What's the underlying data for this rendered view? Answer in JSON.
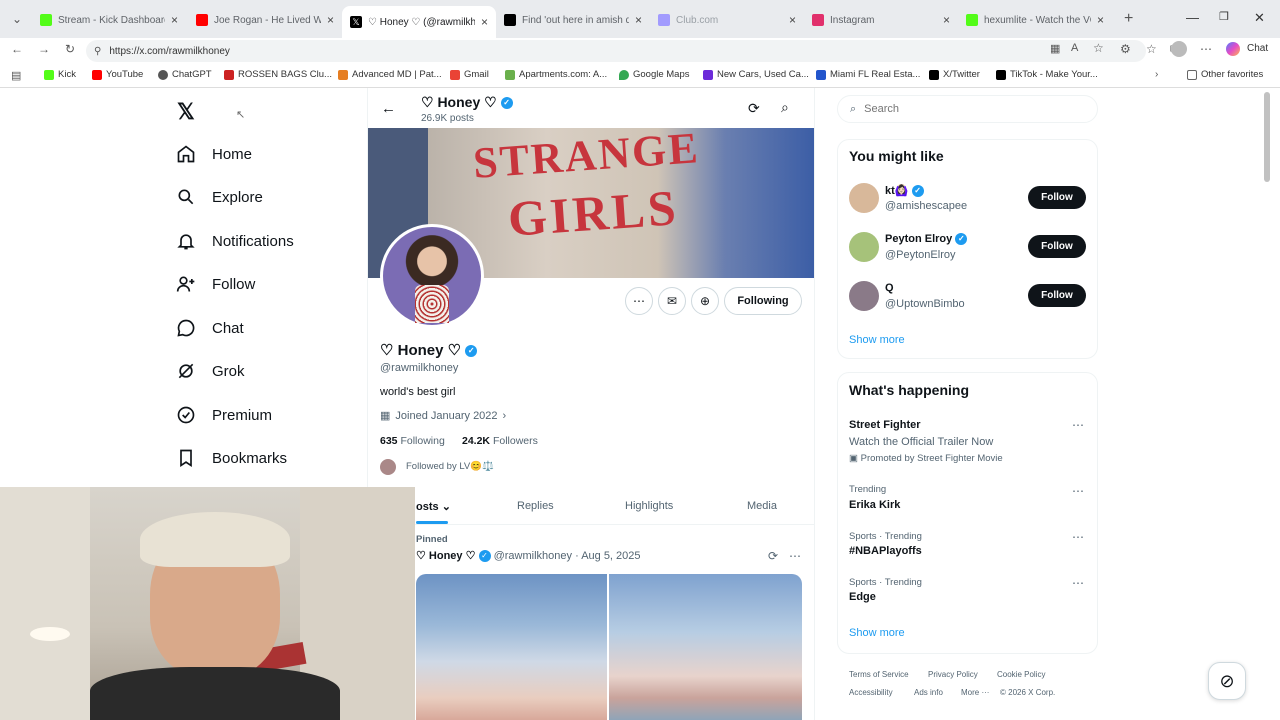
{
  "tabs": [
    {
      "title": "Stream - Kick Dashboard",
      "color": "#53fc18"
    },
    {
      "title": "Joe Rogan - He Lived With M",
      "color": "#ff0000"
    },
    {
      "title": "♡ Honey ♡ (@rawmilkhoney",
      "color": "#000000"
    },
    {
      "title": "Find 'out here in amish doin",
      "color": "#000000"
    },
    {
      "title": "Club.com",
      "color": "#a29bfe"
    },
    {
      "title": "Instagram",
      "color": "#e1306c"
    },
    {
      "title": "hexumlite - Watch the VOD",
      "color": "#53fc18"
    }
  ],
  "address": {
    "url": "https://x.com/rawmilkhoney"
  },
  "browser": {
    "chat_label": "Chat"
  },
  "bookmarks": [
    {
      "label": "Kick",
      "color": "#53fc18"
    },
    {
      "label": "YouTube",
      "color": "#ff0000"
    },
    {
      "label": "ChatGPT",
      "color": "#555555"
    },
    {
      "label": "ROSSEN BAGS Clu...",
      "color": "#cc2222"
    },
    {
      "label": "Advanced MD | Pat...",
      "color": "#e67e22"
    },
    {
      "label": "Gmail",
      "color": "#ea4335"
    },
    {
      "label": "Apartments.com: A...",
      "color": "#6ab04c"
    },
    {
      "label": "Google Maps",
      "color": "#34a853"
    },
    {
      "label": "New Cars, Used Ca...",
      "color": "#6c2bd9"
    },
    {
      "label": "Miami FL Real Esta...",
      "color": "#2255cc"
    },
    {
      "label": "X/Twitter",
      "color": "#000000"
    },
    {
      "label": "TikTok - Make Your...",
      "color": "#000000"
    }
  ],
  "other_favorites": "Other favorites",
  "nav": {
    "home": "Home",
    "explore": "Explore",
    "notifications": "Notifications",
    "follow": "Follow",
    "chat": "Chat",
    "grok": "Grok",
    "premium": "Premium",
    "bookmarks": "Bookmarks"
  },
  "profile": {
    "header_name": "♡ Honey ♡",
    "posts_count": "26.9K posts",
    "banner_text_1": "STRANGE",
    "banner_text_2": "GIRLS",
    "name": "♡ Honey ♡",
    "handle": "@rawmilkhoney",
    "bio": "world's best girl",
    "joined": "Joined January 2022",
    "following_count": "635",
    "following_label": "Following",
    "followers_count": "24.2K",
    "followers_label": "Followers",
    "followed_by": "Followed by LV😊⚖️",
    "following_button": "Following"
  },
  "profile_tabs": [
    "osts",
    "Replies",
    "Highlights",
    "Media"
  ],
  "pinned": {
    "label": "Pinned",
    "name": "♡ Honey ♡",
    "handle": "@rawmilkhoney",
    "date": "Aug 5, 2025"
  },
  "search": {
    "placeholder": "Search"
  },
  "you_might_like": {
    "title": "You might like",
    "items": [
      {
        "name": "kt🙆🏻‍♀️",
        "handle": "@amishescapee",
        "button": "Follow"
      },
      {
        "name": "Peyton Elroy",
        "handle": "@PeytonElroy",
        "button": "Follow"
      },
      {
        "name": "Q",
        "handle": "@UptownBimbo",
        "button": "Follow"
      }
    ],
    "show_more": "Show more"
  },
  "whats_happening": {
    "title": "What's happening",
    "promo": {
      "title": "Street Fighter",
      "subtitle": "Watch the Official Trailer Now",
      "promoted": "Promoted by Street Fighter Movie"
    },
    "items": [
      {
        "context": "Trending",
        "topic": "Erika Kirk"
      },
      {
        "context": "Sports · Trending",
        "topic": "#NBAPlayoffs"
      },
      {
        "context": "Sports · Trending",
        "topic": "Edge"
      }
    ],
    "show_more": "Show more"
  },
  "footer": {
    "terms": "Terms of Service",
    "privacy": "Privacy Policy",
    "cookie": "Cookie Policy",
    "accessibility": "Accessibility",
    "ads": "Ads info",
    "more": "More ···",
    "copyright": "© 2026 X Corp."
  }
}
